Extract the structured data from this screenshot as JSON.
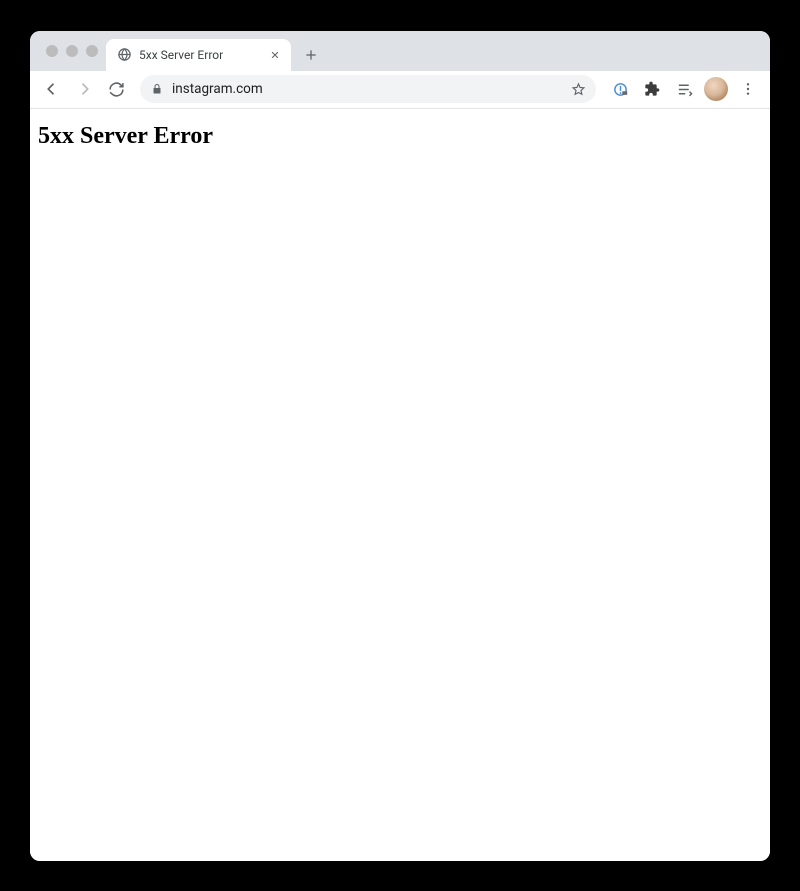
{
  "tab": {
    "title": "5xx Server Error"
  },
  "addressbar": {
    "url": "instagram.com"
  },
  "page": {
    "heading": "5xx Server Error"
  }
}
